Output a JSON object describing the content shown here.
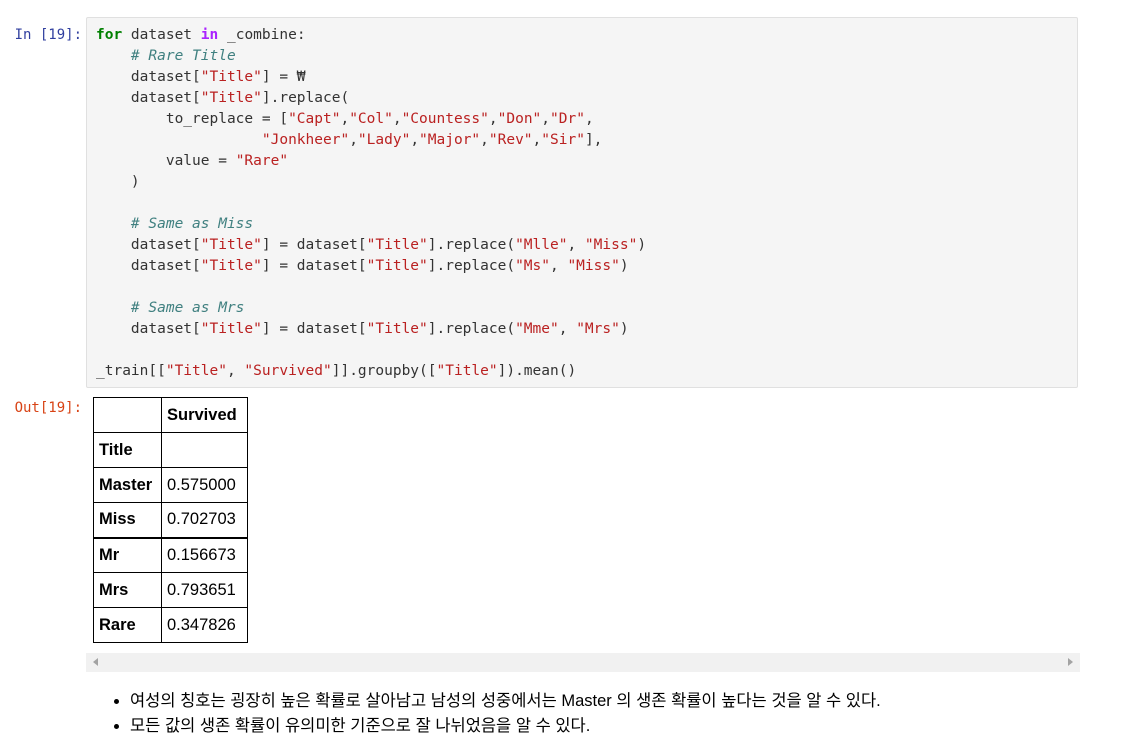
{
  "input_prompt": "In [19]:",
  "output_prompt": "Out[19]:",
  "code_lines": [
    [
      {
        "t": "kw",
        "v": "for"
      },
      {
        "t": "op",
        "v": " dataset "
      },
      {
        "t": "kw2",
        "v": "in"
      },
      {
        "t": "op",
        "v": " _combine:"
      }
    ],
    [
      {
        "t": "op",
        "v": "    "
      },
      {
        "t": "cm",
        "v": "# Rare Title"
      }
    ],
    [
      {
        "t": "op",
        "v": "    dataset["
      },
      {
        "t": "st",
        "v": "\"Title\""
      },
      {
        "t": "op",
        "v": "] = ₩"
      }
    ],
    [
      {
        "t": "op",
        "v": "    dataset["
      },
      {
        "t": "st",
        "v": "\"Title\""
      },
      {
        "t": "op",
        "v": "].replace("
      }
    ],
    [
      {
        "t": "op",
        "v": "        to_replace = ["
      },
      {
        "t": "st",
        "v": "\"Capt\""
      },
      {
        "t": "op",
        "v": ","
      },
      {
        "t": "st",
        "v": "\"Col\""
      },
      {
        "t": "op",
        "v": ","
      },
      {
        "t": "st",
        "v": "\"Countess\""
      },
      {
        "t": "op",
        "v": ","
      },
      {
        "t": "st",
        "v": "\"Don\""
      },
      {
        "t": "op",
        "v": ","
      },
      {
        "t": "st",
        "v": "\"Dr\""
      },
      {
        "t": "op",
        "v": ","
      }
    ],
    [
      {
        "t": "op",
        "v": "                   "
      },
      {
        "t": "st",
        "v": "\"Jonkheer\""
      },
      {
        "t": "op",
        "v": ","
      },
      {
        "t": "st",
        "v": "\"Lady\""
      },
      {
        "t": "op",
        "v": ","
      },
      {
        "t": "st",
        "v": "\"Major\""
      },
      {
        "t": "op",
        "v": ","
      },
      {
        "t": "st",
        "v": "\"Rev\""
      },
      {
        "t": "op",
        "v": ","
      },
      {
        "t": "st",
        "v": "\"Sir\""
      },
      {
        "t": "op",
        "v": "],"
      }
    ],
    [
      {
        "t": "op",
        "v": "        value = "
      },
      {
        "t": "st",
        "v": "\"Rare\""
      }
    ],
    [
      {
        "t": "op",
        "v": "    )"
      }
    ],
    [
      {
        "t": "op",
        "v": ""
      }
    ],
    [
      {
        "t": "op",
        "v": "    "
      },
      {
        "t": "cm",
        "v": "# Same as Miss"
      }
    ],
    [
      {
        "t": "op",
        "v": "    dataset["
      },
      {
        "t": "st",
        "v": "\"Title\""
      },
      {
        "t": "op",
        "v": "] = dataset["
      },
      {
        "t": "st",
        "v": "\"Title\""
      },
      {
        "t": "op",
        "v": "].replace("
      },
      {
        "t": "st",
        "v": "\"Mlle\""
      },
      {
        "t": "op",
        "v": ", "
      },
      {
        "t": "st",
        "v": "\"Miss\""
      },
      {
        "t": "op",
        "v": ")"
      }
    ],
    [
      {
        "t": "op",
        "v": "    dataset["
      },
      {
        "t": "st",
        "v": "\"Title\""
      },
      {
        "t": "op",
        "v": "] = dataset["
      },
      {
        "t": "st",
        "v": "\"Title\""
      },
      {
        "t": "op",
        "v": "].replace("
      },
      {
        "t": "st",
        "v": "\"Ms\""
      },
      {
        "t": "op",
        "v": ", "
      },
      {
        "t": "st",
        "v": "\"Miss\""
      },
      {
        "t": "op",
        "v": ")"
      }
    ],
    [
      {
        "t": "op",
        "v": ""
      }
    ],
    [
      {
        "t": "op",
        "v": "    "
      },
      {
        "t": "cm",
        "v": "# Same as Mrs"
      }
    ],
    [
      {
        "t": "op",
        "v": "    dataset["
      },
      {
        "t": "st",
        "v": "\"Title\""
      },
      {
        "t": "op",
        "v": "] = dataset["
      },
      {
        "t": "st",
        "v": "\"Title\""
      },
      {
        "t": "op",
        "v": "].replace("
      },
      {
        "t": "st",
        "v": "\"Mme\""
      },
      {
        "t": "op",
        "v": ", "
      },
      {
        "t": "st",
        "v": "\"Mrs\""
      },
      {
        "t": "op",
        "v": ")"
      }
    ],
    [
      {
        "t": "op",
        "v": ""
      }
    ],
    [
      {
        "t": "op",
        "v": "_train[["
      },
      {
        "t": "st",
        "v": "\"Title\""
      },
      {
        "t": "op",
        "v": ", "
      },
      {
        "t": "st",
        "v": "\"Survived\""
      },
      {
        "t": "op",
        "v": "]].groupby(["
      },
      {
        "t": "st",
        "v": "\"Title\""
      },
      {
        "t": "op",
        "v": "]).mean()"
      }
    ]
  ],
  "output_table": {
    "column_header": "Survived",
    "index_name": "Title",
    "rows": [
      {
        "label": "Master",
        "value": "0.575000"
      },
      {
        "label": "Miss",
        "value": "0.702703"
      },
      {
        "label": "Mr",
        "value": "0.156673"
      },
      {
        "label": "Mrs",
        "value": "0.793651"
      },
      {
        "label": "Rare",
        "value": "0.347826"
      }
    ]
  },
  "notes": [
    "여성의 칭호는 굉장히 높은 확률로 살아남고 남성의 성중에서는 Master 의 생존 확률이 높다는 것을 알 수 있다.",
    "모든 값의 생존 확률이 유의미한 기준으로 잘 나뉘었음을 알 수 있다."
  ]
}
